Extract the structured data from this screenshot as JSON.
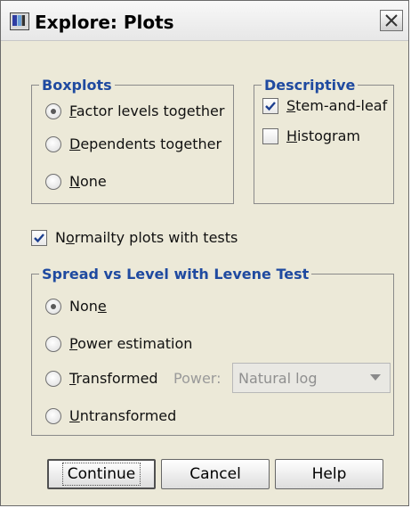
{
  "window": {
    "title": "Explore: Plots"
  },
  "boxplots": {
    "legend": "Boxplots",
    "options": [
      {
        "mn": "F",
        "rest": "actor levels together",
        "selected": true
      },
      {
        "mn": "D",
        "rest": "ependents together",
        "selected": false
      },
      {
        "mn": "N",
        "rest": "one",
        "selected": false
      }
    ]
  },
  "descriptive": {
    "legend": "Descriptive",
    "stem": {
      "mn": "S",
      "rest": "tem-and-leaf",
      "checked": true
    },
    "histogram": {
      "mn": "H",
      "rest": "istogram",
      "checked": false
    }
  },
  "normality": {
    "pre": "N",
    "mn": "o",
    "rest": "rmailty plots with tests",
    "checked": true
  },
  "spread": {
    "legend": "Spread vs Level with Levene Test",
    "none": {
      "pre": "Non",
      "mn": "e",
      "selected": true
    },
    "power_estimation": {
      "mn": "P",
      "rest": "ower estimation",
      "selected": false
    },
    "transformed": {
      "mn": "T",
      "rest": "ransformed",
      "selected": false
    },
    "power_label": "Power:",
    "power_select_value": "Natural log",
    "untransformed": {
      "mn": "U",
      "rest": "ntransformed",
      "selected": false
    }
  },
  "buttons": {
    "continue": "Continue",
    "cancel": "Cancel",
    "help": "Help"
  }
}
